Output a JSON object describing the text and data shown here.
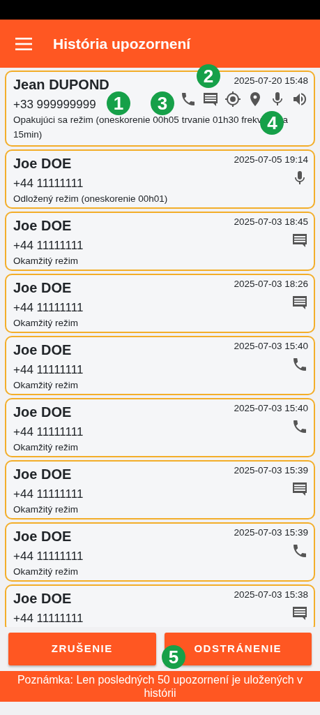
{
  "app_bar": {
    "title": "História upozornení"
  },
  "alerts": [
    {
      "name": "Jean DUPOND",
      "phone": "+33 999999999",
      "datetime": "2025-07-20 15:48",
      "mode_segments": [
        "Opakujúci sa režim (oneskorenie 00h05 trvanie 01h30 frekv",
        "a",
        "15min)"
      ],
      "icons": [
        {
          "kind": "phone"
        },
        {
          "kind": "message"
        },
        {
          "kind": "target"
        },
        {
          "kind": "pin"
        },
        {
          "kind": "mic"
        },
        {
          "kind": "speaker"
        }
      ]
    },
    {
      "name": "Joe DOE",
      "phone": "+44 11111111",
      "datetime": "2025-07-05 19:14",
      "mode_segments": [
        "Odložený režim (oneskorenie 00h01)"
      ],
      "icons": [
        {
          "kind": "mic"
        }
      ]
    },
    {
      "name": "Joe DOE",
      "phone": "+44 11111111",
      "datetime": "2025-07-03 18:45",
      "mode_segments": [
        "Okamžitý režim"
      ],
      "icons": [
        {
          "kind": "message"
        }
      ]
    },
    {
      "name": "Joe DOE",
      "phone": "+44 11111111",
      "datetime": "2025-07-03 18:26",
      "mode_segments": [
        "Okamžitý režim"
      ],
      "icons": [
        {
          "kind": "message"
        }
      ]
    },
    {
      "name": "Joe DOE",
      "phone": "+44 11111111",
      "datetime": "2025-07-03 15:40",
      "mode_segments": [
        "Okamžitý režim"
      ],
      "icons": [
        {
          "kind": "phone"
        }
      ]
    },
    {
      "name": "Joe DOE",
      "phone": "+44 11111111",
      "datetime": "2025-07-03 15:40",
      "mode_segments": [
        "Okamžitý režim"
      ],
      "icons": [
        {
          "kind": "phone"
        }
      ]
    },
    {
      "name": "Joe DOE",
      "phone": "+44 11111111",
      "datetime": "2025-07-03 15:39",
      "mode_segments": [
        "Okamžitý režim"
      ],
      "icons": [
        {
          "kind": "message"
        }
      ]
    },
    {
      "name": "Joe DOE",
      "phone": "+44 11111111",
      "datetime": "2025-07-03 15:39",
      "mode_segments": [
        "Okamžitý režim"
      ],
      "icons": [
        {
          "kind": "phone"
        }
      ]
    },
    {
      "name": "Joe DOE",
      "phone": "+44 11111111",
      "datetime": "2025-07-03 15:38",
      "icons": [
        {
          "kind": "message"
        }
      ]
    }
  ],
  "buttons": [
    "ZRUŠENIE",
    "ODSTRÁNENIE"
  ],
  "note": "Poznámka: Len posledných 50 upozornení je uložených v histórii",
  "callouts": [
    "1",
    "2",
    "3",
    "4",
    "5"
  ]
}
